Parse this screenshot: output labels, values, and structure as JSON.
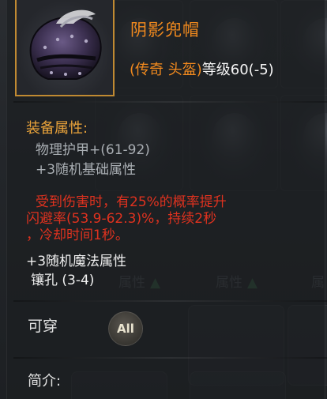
{
  "item": {
    "name": "阴影兜帽",
    "rarity": "(传奇 头盔)",
    "level_text": "等级60(-5)",
    "icon": "hooded-helmet-icon"
  },
  "attributes": {
    "title": "装备属性:",
    "stats": [
      "物理护甲+(61-92)",
      "+3随机基础属性"
    ]
  },
  "effect": {
    "line1": "受到伤害时，有25%的概率提升",
    "line2": "闪避率(53.9-62.3)%，持续2秒",
    "line3": "，冷却时间1秒。"
  },
  "extras": {
    "magic_attr": "+3随机魔法属性",
    "socket": "镶孔 (3-4)"
  },
  "wearable": {
    "label": "可穿",
    "class_badge": "All"
  },
  "intro": {
    "label": "简介:"
  },
  "background": {
    "slot_label_1": "属性",
    "slot_label_2": "属性",
    "slot_label_3": "属"
  },
  "colors": {
    "legendary": "#f28a1e",
    "section_title": "#e8a23a",
    "effect_red": "#e0321f",
    "icon_border": "#c08a32"
  }
}
